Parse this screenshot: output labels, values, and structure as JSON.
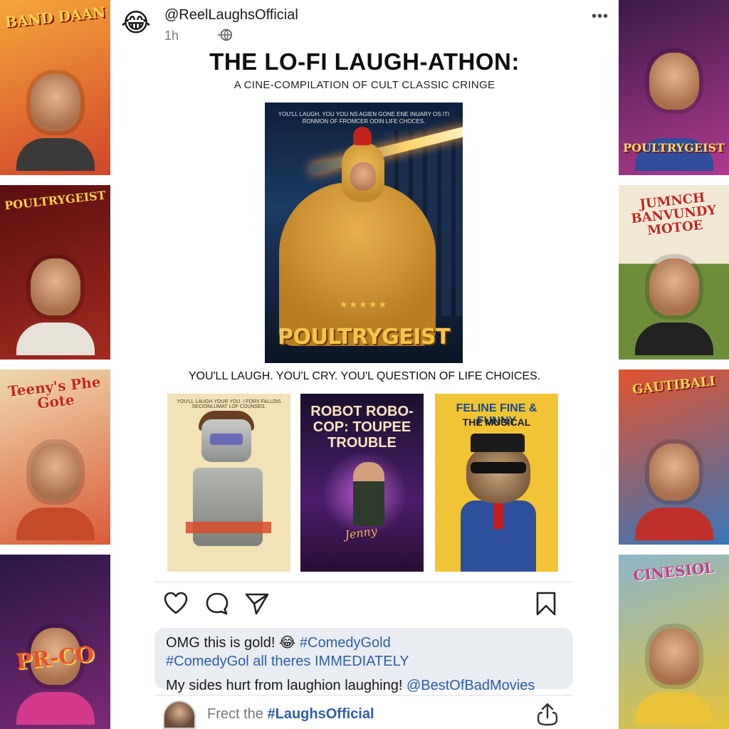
{
  "post": {
    "avatar_emoji": "😂",
    "username": "@ReelLaughsOfficial",
    "time": "1h",
    "headline": "THE LO-FI LAUGH-ATHON:",
    "subhead": "A CINE-COMPILATION OF CULT CLASSIC CRINGE",
    "question": "YOU'LL LAUGH. YOU'L CRY. YOU'L QUESTION OF LIFE CHOICES."
  },
  "hero_poster": {
    "tagline": "YOU'LL LAUGH. YOU YOU NS AGIEN GONE ENE INUARY OS ITI RONMON OF FROMCER ODIN LIFE CHOCES.",
    "stars": "★★★★★",
    "title": "POULTRYGEIST"
  },
  "mini_posters": {
    "robot": {
      "tagline": "YOU'LL LAUGH YOUR YOU. I FORX FALLDIS SECIONLUMAT LOF COUNSES."
    },
    "robocop": {
      "title": "ROBOT ROBO-COP: TOUPEE TROUBLE",
      "script": "Jenny"
    },
    "feline": {
      "title": "FELINE FINE & FUNNY",
      "subtitle": "THE MUSICAL"
    }
  },
  "side_posters": {
    "left": [
      {
        "title": "BAND DAAN",
        "color": "#f39a2b"
      },
      {
        "title": "POULTRYGEIST",
        "color": "#8a1b1b"
      },
      {
        "title": "Teeny's Phe Gote",
        "color": "#e7cfa2"
      },
      {
        "title": "PR-CO",
        "color": "#3b1d5e"
      }
    ],
    "right": [
      {
        "title": "POULTRYGEIST",
        "color": "#7a1f6a"
      },
      {
        "title": "JUMNCH BANVUNDY MOTOE",
        "color": "#e9e1cf"
      },
      {
        "title": "GAUTIBALI",
        "color": "#d3402b"
      },
      {
        "title": "CINESIOL",
        "color": "#6d8a3e"
      }
    ]
  },
  "comments": {
    "line1_text": "OMG this is gold! 😂 ",
    "line1_tag": "#ComedyGold",
    "line2_tag": "#ComedyGol",
    "line2_text": " all theres IMMEDIATELY",
    "line3_text": "My sides hurt from laughion laughing! ",
    "line3_tag": "@BestOfBadMovies"
  },
  "reply": {
    "prefix": "Frect the ",
    "tag": "#LaughsOfficial"
  },
  "icons": [
    "heart-icon",
    "comment-icon",
    "send-icon",
    "bookmark-icon",
    "share-icon",
    "globe-icon",
    "more-icon"
  ]
}
